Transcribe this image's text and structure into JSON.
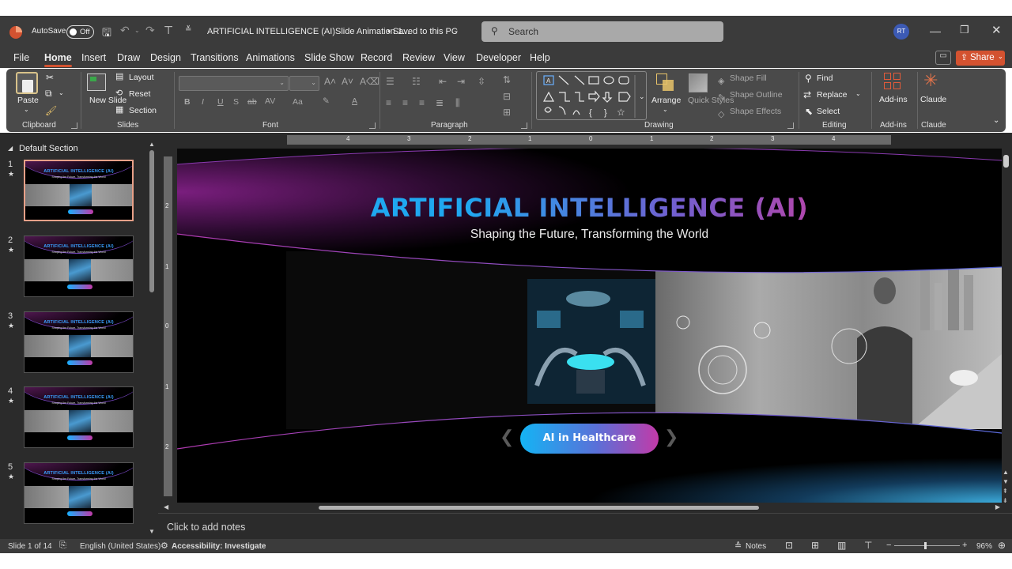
{
  "titlebar": {
    "autosave_label": "AutoSave",
    "autosave_state": "Off",
    "doc_title": "ARTIFICIAL INTELLIGENCE (AI)Slide Animation 1...",
    "save_status": "• Saved to this PC",
    "search_placeholder": "Search",
    "user_initials": "RT"
  },
  "menu": {
    "items": [
      "File",
      "Home",
      "Insert",
      "Draw",
      "Design",
      "Transitions",
      "Animations",
      "Slide Show",
      "Record",
      "Review",
      "View",
      "Developer",
      "Help"
    ],
    "share_label": "Share"
  },
  "ribbon": {
    "clipboard": {
      "paste": "Paste",
      "label": "Clipboard"
    },
    "slides": {
      "new_slide": "New Slide",
      "layout": "Layout",
      "reset": "Reset",
      "section": "Section",
      "label": "Slides"
    },
    "font": {
      "label": "Font"
    },
    "paragraph": {
      "label": "Paragraph"
    },
    "drawing": {
      "arrange": "Arrange",
      "quick_styles": "Quick Styles",
      "shape_fill": "Shape Fill",
      "shape_outline": "Shape Outline",
      "shape_effects": "Shape Effects",
      "label": "Drawing"
    },
    "editing": {
      "find": "Find",
      "replace": "Replace",
      "select": "Select",
      "label": "Editing"
    },
    "addins": {
      "addins": "Add-ins",
      "label": "Add-ins"
    },
    "claude": {
      "claude": "Claude",
      "label": "Claude"
    }
  },
  "panel": {
    "section_name": "Default Section",
    "slides": [
      {
        "num": "1",
        "title": "ARTIFICIAL INTELLIGENCE (AI)"
      },
      {
        "num": "2",
        "title": "ARTIFICIAL INTELLIGENCE (AI)"
      },
      {
        "num": "3",
        "title": "ARTIFICIAL INTELLIGENCE (AI)"
      },
      {
        "num": "4",
        "title": "ARTIFICIAL INTELLIGENCE (AI)"
      },
      {
        "num": "5",
        "title": "ARTIFICIAL INTELLIGENCE (AI)"
      }
    ],
    "thumb_subtitle": "Shaping the Future, Transforming the World"
  },
  "ruler": {
    "h_ticks": [
      "4",
      "3",
      "2",
      "1",
      "0",
      "1",
      "2",
      "3",
      "4"
    ],
    "v_ticks": [
      "2",
      "1",
      "0",
      "1",
      "2"
    ]
  },
  "slide": {
    "title": "ARTIFICIAL INTELLIGENCE (AI)",
    "subtitle": "Shaping the Future, Transforming the World",
    "button_label": "AI in Healthcare",
    "prev_arrow": "❮",
    "next_arrow": "❯"
  },
  "notes": {
    "placeholder": "Click to add notes"
  },
  "status": {
    "slide_info": "Slide 1 of 14",
    "language": "English (United States)",
    "accessibility": "Accessibility: Investigate",
    "notes_label": "Notes",
    "zoom": "96%"
  },
  "colors": {
    "accent": "#d35230",
    "title_gradient_start": "#1fa8f0",
    "title_gradient_end": "#d03a9a"
  }
}
